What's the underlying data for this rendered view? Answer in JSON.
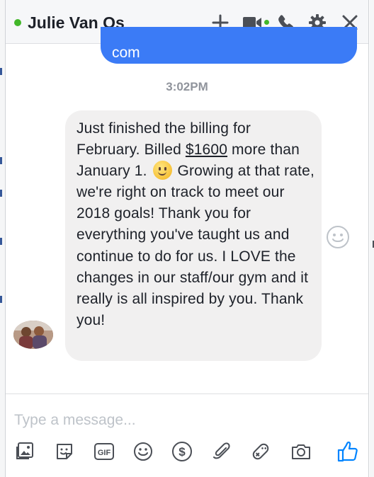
{
  "chat": {
    "contact_name": "Julie Van Os",
    "contact_status": "online"
  },
  "header_icons": [
    "plus-icon",
    "video-call-icon",
    "phone-icon",
    "gear-icon",
    "close-icon"
  ],
  "messages": {
    "outgoing_tail_text": "com",
    "timestamp": "3:02PM",
    "incoming": {
      "part1": "Just finished the billing for February. Billed ",
      "amount": "$1600",
      "part2": " more than January 1. ",
      "part3": " Growing at that rate, we're right on track to meet our 2018 goals! Thank you for everything you've taught us and continue to do for us. I LOVE the changes in our staff/our gym and it really is all inspired by you. Thank you!",
      "emoji": "slightly-smiling-face"
    }
  },
  "composer": {
    "placeholder": "Type a message...",
    "tools": [
      "photo-icon",
      "sticker-icon",
      "gif-icon",
      "emoji-icon",
      "payment-icon",
      "attachment-icon",
      "game-icon",
      "camera-icon",
      "like-icon"
    ]
  },
  "colors": {
    "accent": "#3b7bf6",
    "like_blue": "#0084ff",
    "online_green": "#42b72a",
    "incoming_bubble": "#f1f0f0",
    "icon_gray": "#4b4f56"
  }
}
